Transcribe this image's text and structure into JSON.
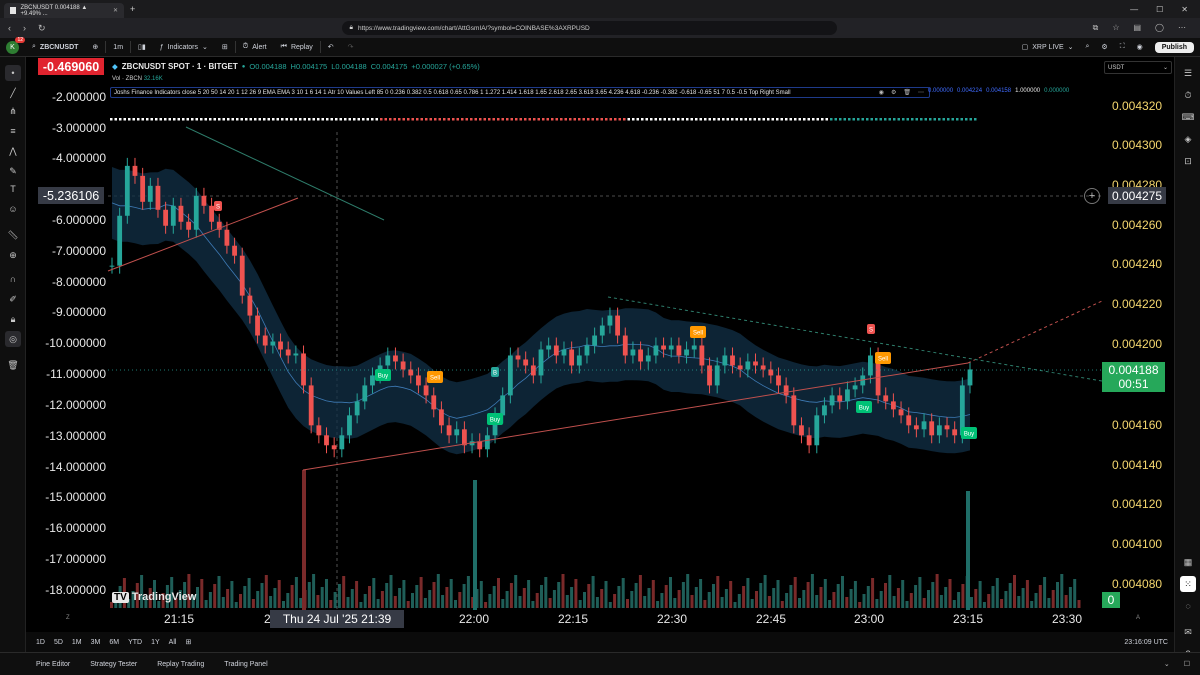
{
  "browser": {
    "tab_title": "ZBCNUSDT 0.004188 ▲ +9.49% ...",
    "url": "https://www.tradingview.com/chart/AttGsmIA/?symbol=COINBASE%3AXRPUSD"
  },
  "toolbar": {
    "avatar_letter": "K",
    "avatar_badge": "12",
    "symbol": "ZBCNUSDT",
    "interval": "1m",
    "indicators_label": "Indicators",
    "alert_label": "Alert",
    "replay_label": "Replay",
    "layout_name": "XRP LIVE",
    "publish_label": "Publish"
  },
  "legend": {
    "symbol_line": "ZBCNUSDT SPOT · 1 · BITGET",
    "open": "O0.004188",
    "high": "H0.004175",
    "low": "L0.004188",
    "close": "C0.004175",
    "change": "+0.000027 (+0.65%)",
    "volume_label": "Vol · ZBCN",
    "volume_value": "32.16K",
    "indicator_text": "Joshs Finance Indicators close 5 20 50 14 20 1 12 26 9 EMA EMA 3 10 1 6 14 1 Atr 10 Values Left 85 0 0.236 0.382 0.5 0.618 0.65 0.786 1 1.272 1.414 1.618 1.65 2.618 2.65 3.618 3.65 4.236 4.618 -0.236 -0.382 -0.618 -0.65 51 7 0.5 -0.5 Top Right Small",
    "indicator_values": [
      "0.000000",
      "0.004224",
      "0.004158",
      "1.000000",
      "0.000000"
    ]
  },
  "left_axis": {
    "current_value": "-0.469060",
    "crosshair_value": "-5.236106",
    "ticks": [
      "-2.000000",
      "-3.000000",
      "-4.000000",
      "-6.000000",
      "-7.000000",
      "-8.000000",
      "-9.000000",
      "-10.000000",
      "-11.000000",
      "-12.000000",
      "-13.000000",
      "-14.000000",
      "-15.000000",
      "-16.000000",
      "-17.000000",
      "-18.000000"
    ]
  },
  "right_axis": {
    "currency": "USDT",
    "ticks": [
      "0.004320",
      "0.004300",
      "0.004280",
      "0.004260",
      "0.004240",
      "0.004220",
      "0.004200",
      "0.004160",
      "0.004140",
      "0.004120",
      "0.004100",
      "0.004080"
    ],
    "crosshair_value": "0.004275",
    "current_price": "0.004188",
    "countdown": "00:51",
    "volume_zero": "0"
  },
  "time_axis": {
    "ticks": [
      "21:15",
      "2",
      "22:00",
      "22:15",
      "22:30",
      "22:45",
      "23:00",
      "23:15",
      "23:30"
    ],
    "crosshair_label": "Thu 24 Jul '25   21:39",
    "timezone_clock": "23:16:09 UTC"
  },
  "signals": {
    "buy": "Buy",
    "sell": "Sell",
    "b": "B",
    "s": "S"
  },
  "watermark": "TradingView",
  "range_buttons": [
    "1D",
    "5D",
    "1M",
    "3M",
    "6M",
    "YTD",
    "1Y",
    "All"
  ],
  "bottom_tabs": [
    "Pine Editor",
    "Strategy Tester",
    "Replay Trading",
    "Trading Panel"
  ],
  "colors": {
    "up": "#26a69a",
    "down": "#ef5350",
    "price_label": "#26a85a",
    "axis_text": "#f5d76e",
    "crosshair_label": "#363a45"
  }
}
